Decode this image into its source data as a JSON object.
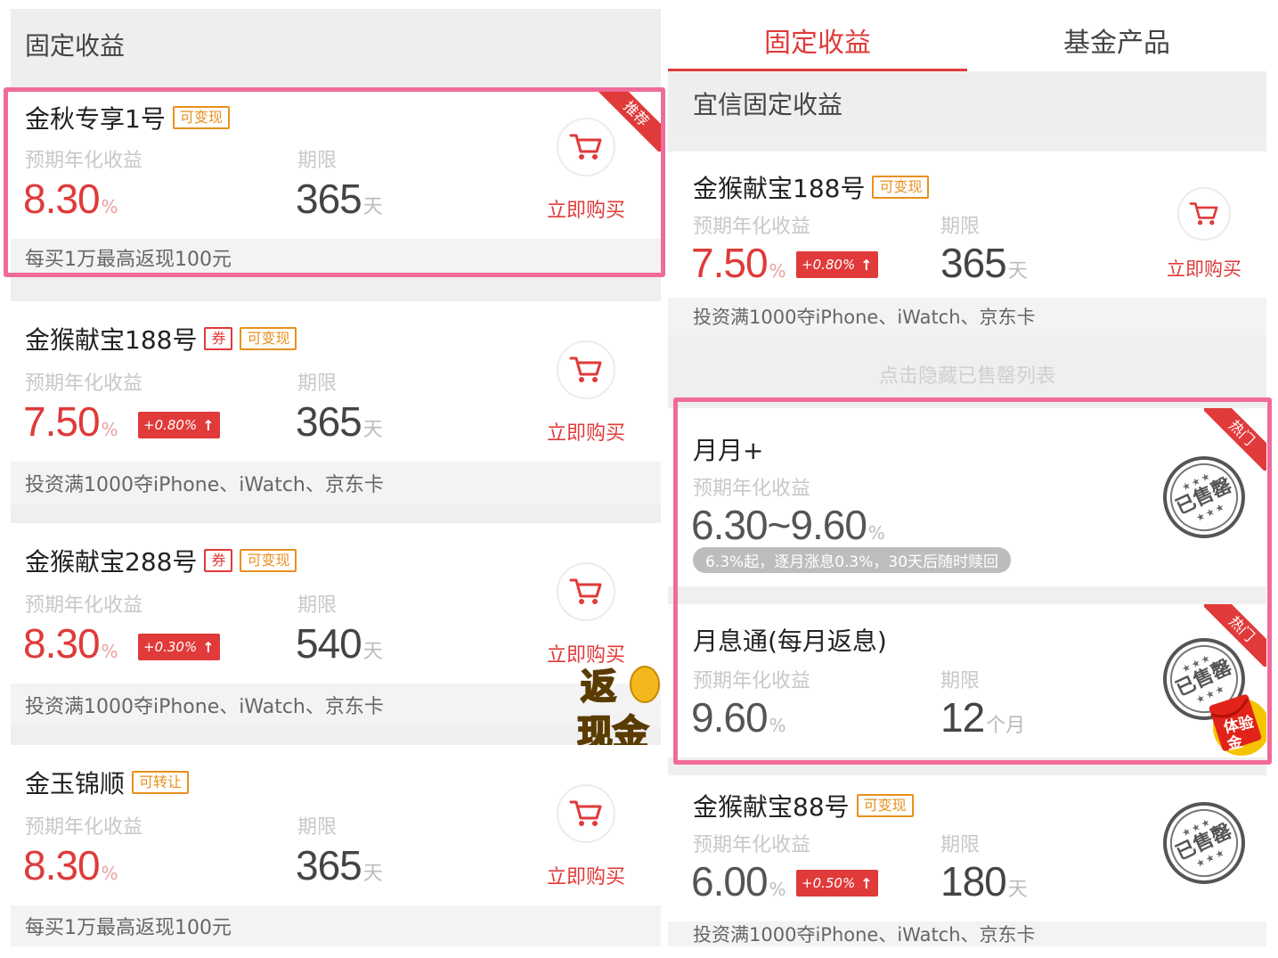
{
  "left": {
    "header": "固定收益",
    "cards": [
      {
        "name": "金秋专享1号",
        "tags": [
          {
            "text": "可变现",
            "style": "orange"
          }
        ],
        "rate_label": "预期年化收益",
        "rate": "8.30",
        "rate_unit": "%",
        "term_label": "期限",
        "term": "365",
        "term_unit": "天",
        "buy": "立即购买",
        "footer": "每买1万最高返现100元",
        "corner": "推荐"
      },
      {
        "name": "金猴献宝188号",
        "tags": [
          {
            "text": "券",
            "style": "red"
          },
          {
            "text": "可变现",
            "style": "orange"
          }
        ],
        "rate_label": "预期年化收益",
        "rate": "7.50",
        "rate_unit": "%",
        "boost": "+0.80%",
        "term_label": "期限",
        "term": "365",
        "term_unit": "天",
        "buy": "立即购买",
        "footer": "投资满1000夺iPhone、iWatch、京东卡"
      },
      {
        "name": "金猴献宝288号",
        "tags": [
          {
            "text": "券",
            "style": "red"
          },
          {
            "text": "可变现",
            "style": "orange"
          }
        ],
        "rate_label": "预期年化收益",
        "rate": "8.30",
        "rate_unit": "%",
        "boost": "+0.30%",
        "term_label": "期限",
        "term": "540",
        "term_unit": "天",
        "buy": "立即购买",
        "footer": "投资满1000夺iPhone、iWatch、京东卡",
        "badge": "返现金"
      },
      {
        "name": "金玉锦顺",
        "tags": [
          {
            "text": "可转让",
            "style": "orange"
          }
        ],
        "rate_label": "预期年化收益",
        "rate": "8.30",
        "rate_unit": "%",
        "term_label": "期限",
        "term": "365",
        "term_unit": "天",
        "buy": "立即购买",
        "footer": "每买1万最高返现100元"
      }
    ]
  },
  "right": {
    "tabs": [
      {
        "label": "固定收益",
        "active": true
      },
      {
        "label": "基金产品",
        "active": false
      }
    ],
    "section": "宜信固定收益",
    "card1": {
      "name": "金猴献宝188号",
      "tag": "可变现",
      "rate_label": "预期年化收益",
      "rate": "7.50",
      "rate_unit": "%",
      "boost": "+0.80%",
      "term_label": "期限",
      "term": "365",
      "term_unit": "天",
      "buy": "立即购买",
      "footer": "投资满1000夺iPhone、iWatch、京东卡"
    },
    "hide_link": "点击隐藏已售罄列表",
    "card2": {
      "name": "月月+",
      "rate_label": "预期年化收益",
      "rate": "6.30~9.60",
      "rate_unit": "%",
      "note": "6.3%起，逐月涨息0.3%，30天后随时赎回",
      "stamp": "已售罄",
      "corner": "热门"
    },
    "card3": {
      "name": "月息通(每月返息)",
      "rate_label": "预期年化收益",
      "rate": "9.60",
      "rate_unit": "%",
      "term_label": "期限",
      "term": "12",
      "term_unit": "个月",
      "stamp": "已售罄",
      "corner": "热门",
      "envelope": "体验金"
    },
    "card4": {
      "name": "金猴献宝88号",
      "tag": "可变现",
      "rate_label": "预期年化收益",
      "rate": "6.00",
      "rate_unit": "%",
      "boost": "+0.50%",
      "term_label": "期限",
      "term": "180",
      "term_unit": "天",
      "stamp": "已售罄",
      "footer": "投资满1000夺iPhone、iWatch、京东卡"
    }
  },
  "colors": {
    "accent": "#e03a3a",
    "tag_orange": "#e8901e",
    "highlight": "#f06b9b",
    "muted": "#c8c8c8",
    "bg": "#efefef"
  },
  "icons": [
    "shopping-cart-icon",
    "up-arrow-icon",
    "sold-out-stamp",
    "cash-back-badge",
    "red-envelope-icon"
  ]
}
